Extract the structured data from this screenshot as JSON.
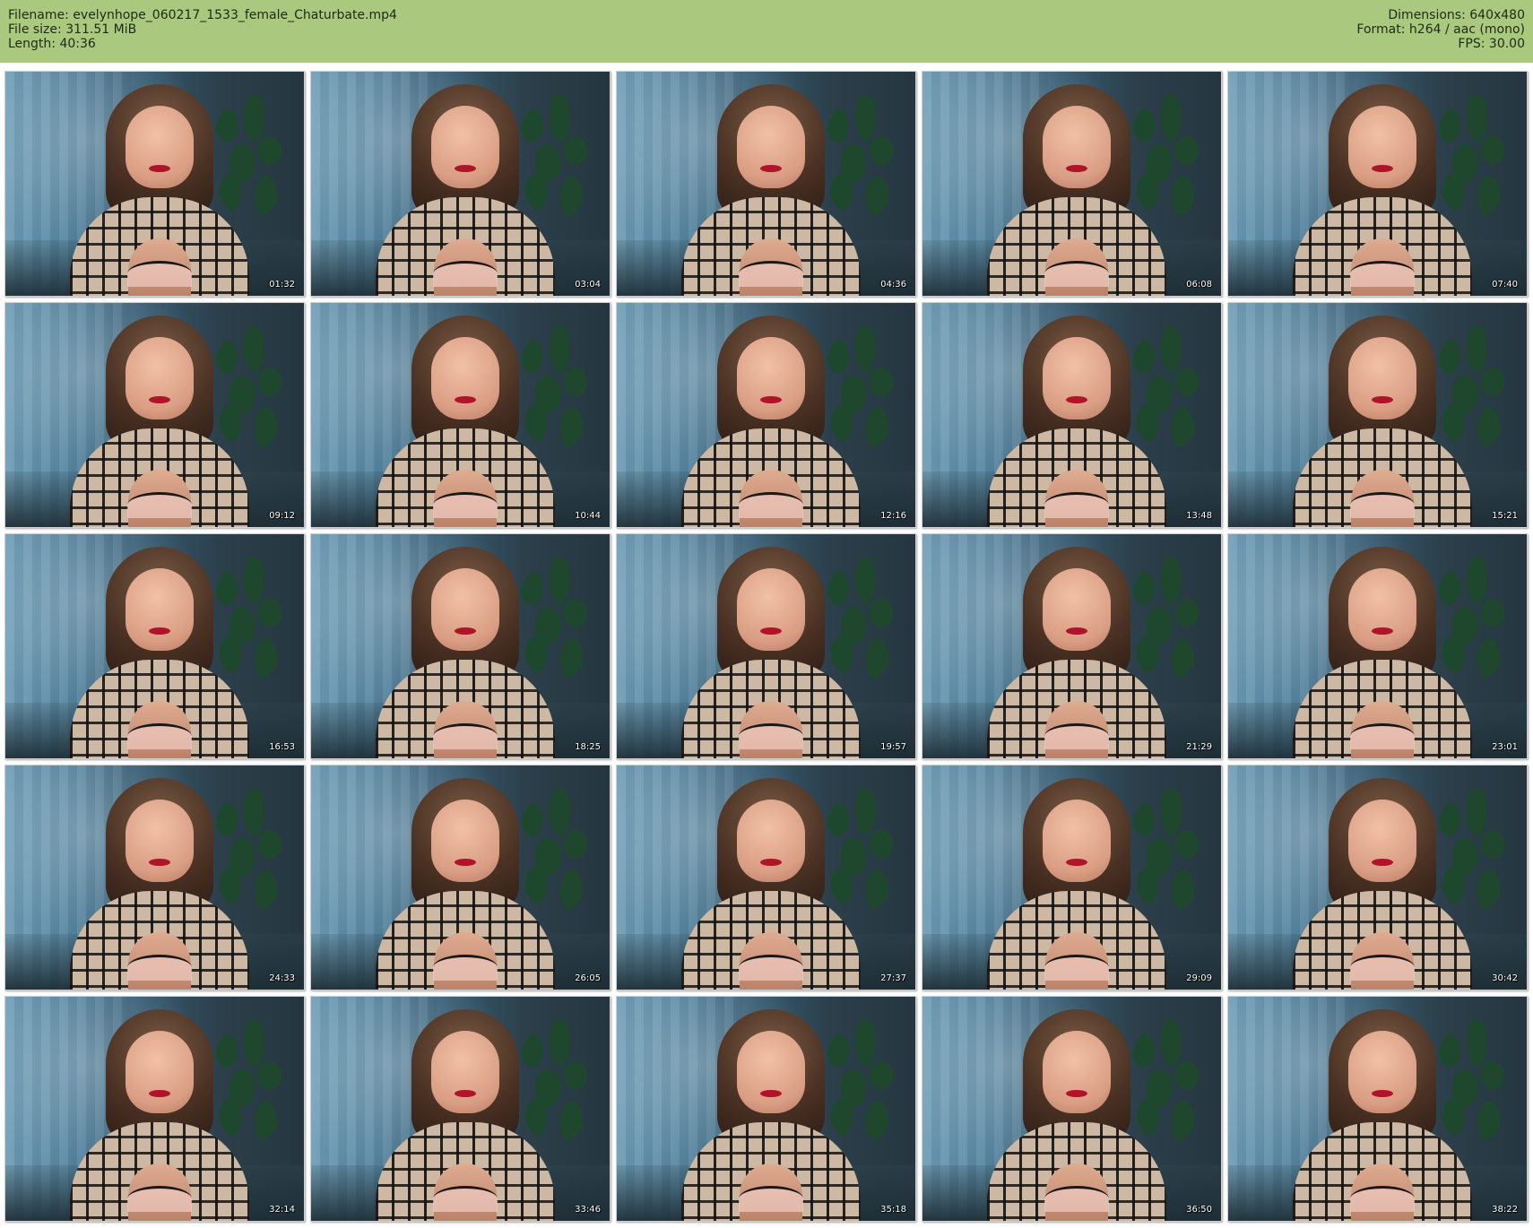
{
  "header": {
    "filename_label": "Filename: evelynhope_060217_1533_female_Chaturbate.mp4",
    "file_size_label": "File size: 311.51 MiB",
    "length_label": "Length: 40:36",
    "dimensions_label": "Dimensions: 640x480",
    "format_label": "Format: h264 / aac (mono)",
    "fps_label": "FPS: 30.00"
  },
  "thumbnails": [
    {
      "timestamp": "01:32"
    },
    {
      "timestamp": "03:04"
    },
    {
      "timestamp": "04:36"
    },
    {
      "timestamp": "06:08"
    },
    {
      "timestamp": "07:40"
    },
    {
      "timestamp": "09:12"
    },
    {
      "timestamp": "10:44"
    },
    {
      "timestamp": "12:16"
    },
    {
      "timestamp": "13:48"
    },
    {
      "timestamp": "15:21"
    },
    {
      "timestamp": "16:53"
    },
    {
      "timestamp": "18:25"
    },
    {
      "timestamp": "19:57"
    },
    {
      "timestamp": "21:29"
    },
    {
      "timestamp": "23:01"
    },
    {
      "timestamp": "24:33"
    },
    {
      "timestamp": "26:05"
    },
    {
      "timestamp": "27:37"
    },
    {
      "timestamp": "29:09"
    },
    {
      "timestamp": "30:42"
    },
    {
      "timestamp": "32:14"
    },
    {
      "timestamp": "33:46"
    },
    {
      "timestamp": "35:18"
    },
    {
      "timestamp": "36:50"
    },
    {
      "timestamp": "38:22"
    }
  ],
  "colors": {
    "header_background": "#aac97e",
    "page_background": "#ffffff",
    "timestamp_text": "#ffffff"
  }
}
